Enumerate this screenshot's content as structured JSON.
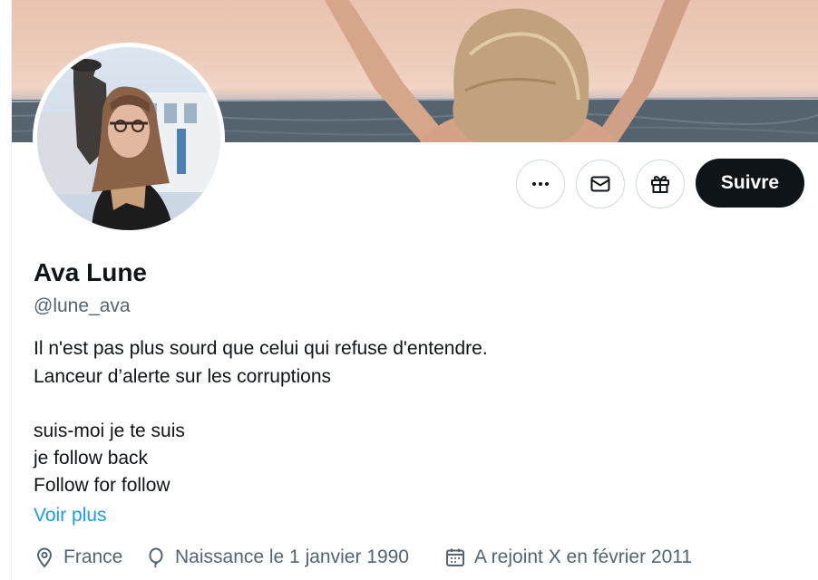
{
  "profile": {
    "display_name": "Ava Lune",
    "handle": "@lune_ava",
    "bio_lines": [
      "Il n'est pas plus sourd que celui qui refuse d'entendre.",
      "Lanceur d’alerte sur les corruptions",
      "suis-moi je te suis",
      "je follow back",
      "Follow for follow"
    ],
    "see_more_label": "Voir plus",
    "location": "France",
    "birthday": "Naissance le 1 janvier 1990",
    "joined": "A rejoint X en février 2011"
  },
  "actions": {
    "more_icon": "more-horizontal-icon",
    "message_icon": "envelope-icon",
    "gift_icon": "gift-icon",
    "follow_label": "Suivre"
  },
  "colors": {
    "text_primary": "#0f1419",
    "text_secondary": "#536471",
    "link": "#1d9bf0",
    "follow_button_bg": "#0f1419",
    "border": "#cfd9de"
  }
}
